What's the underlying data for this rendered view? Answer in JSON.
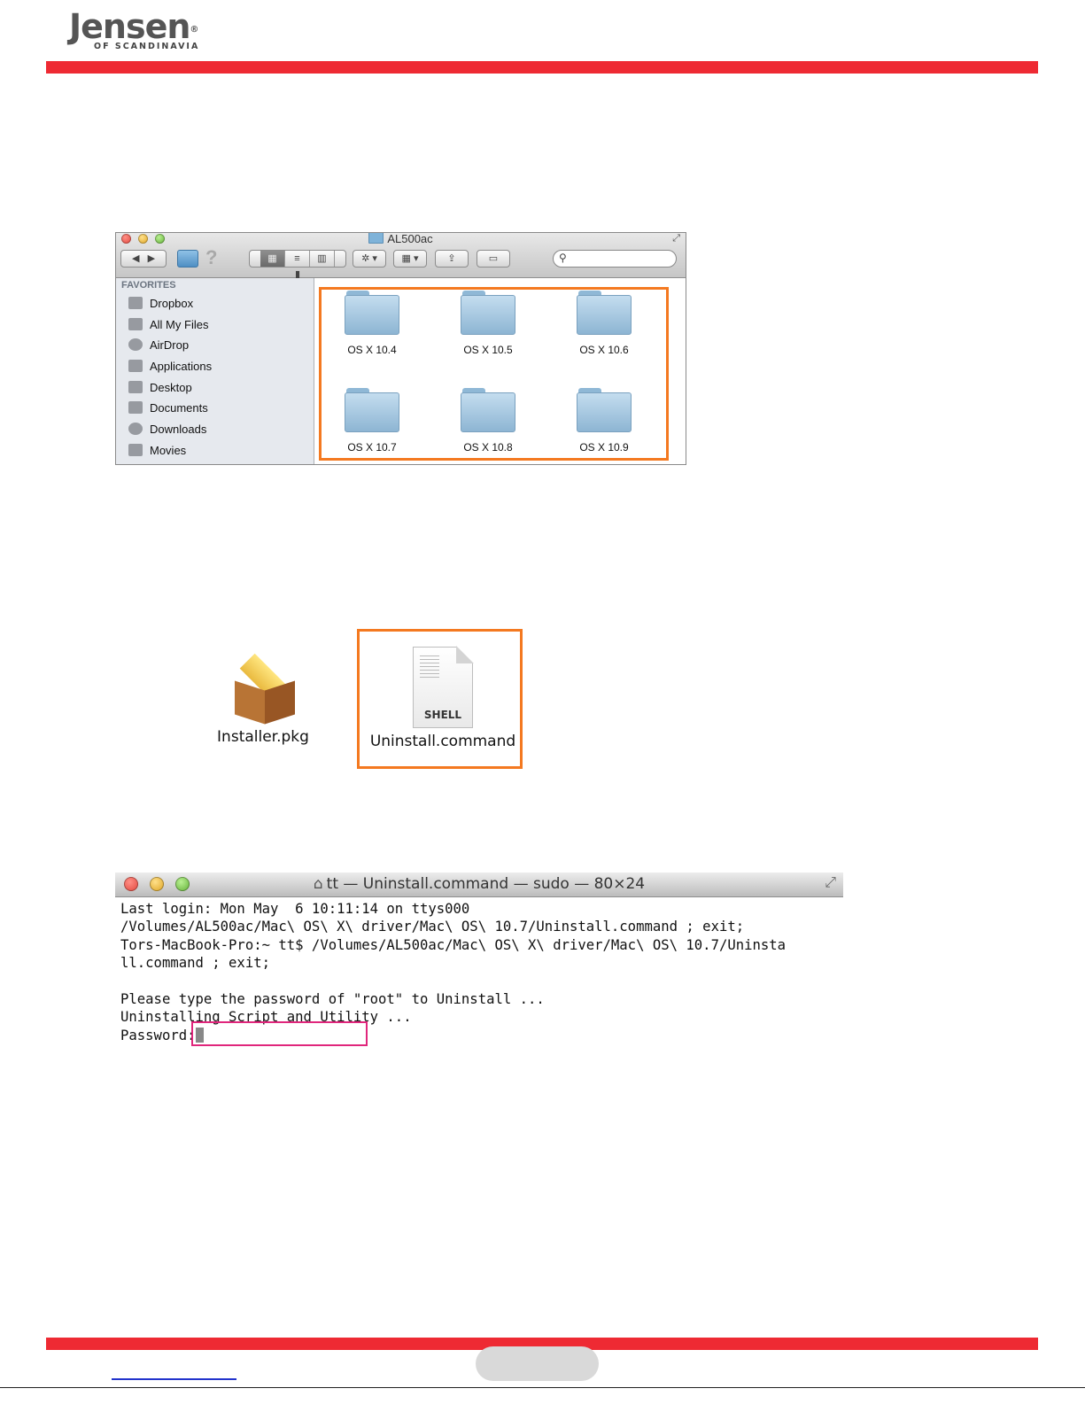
{
  "header": {
    "logo_main": "Jensen",
    "logo_mark": "®",
    "logo_sub": "OF SCANDINAVIA",
    "bar_color": "#ee2a33"
  },
  "finder": {
    "title": "AL500ac",
    "sidebar_heading": "FAVORITES",
    "sidebar_items": [
      "Dropbox",
      "All My Files",
      "AirDrop",
      "Applications",
      "Desktop",
      "Documents",
      "Downloads",
      "Movies"
    ],
    "folders": [
      "OS X 10.4",
      "OS X 10.5",
      "OS X 10.6",
      "OS X 10.7",
      "OS X 10.8",
      "OS X 10.9"
    ],
    "highlight_color": "#f47920"
  },
  "files": {
    "installer_label": "Installer.pkg",
    "uninstall_label": "Uninstall.command",
    "uninstall_icon_text": "SHELL"
  },
  "terminal": {
    "title": "tt — Uninstall.command — sudo — 80×24",
    "lines": [
      "Last login: Mon May  6 10:11:14 on ttys000",
      "/Volumes/AL500ac/Mac\\ OS\\ X\\ driver/Mac\\ OS\\ 10.7/Uninstall.command ; exit;",
      "Tors-MacBook-Pro:~ tt$ /Volumes/AL500ac/Mac\\ OS\\ X\\ driver/Mac\\ OS\\ 10.7/Uninsta",
      "ll.command ; exit;",
      "",
      "Please type the password of \"root\" to Uninstall ...",
      "Uninstalling Script and Utility ..."
    ],
    "prompt": "Password:",
    "highlight_color": "#e0267c"
  }
}
